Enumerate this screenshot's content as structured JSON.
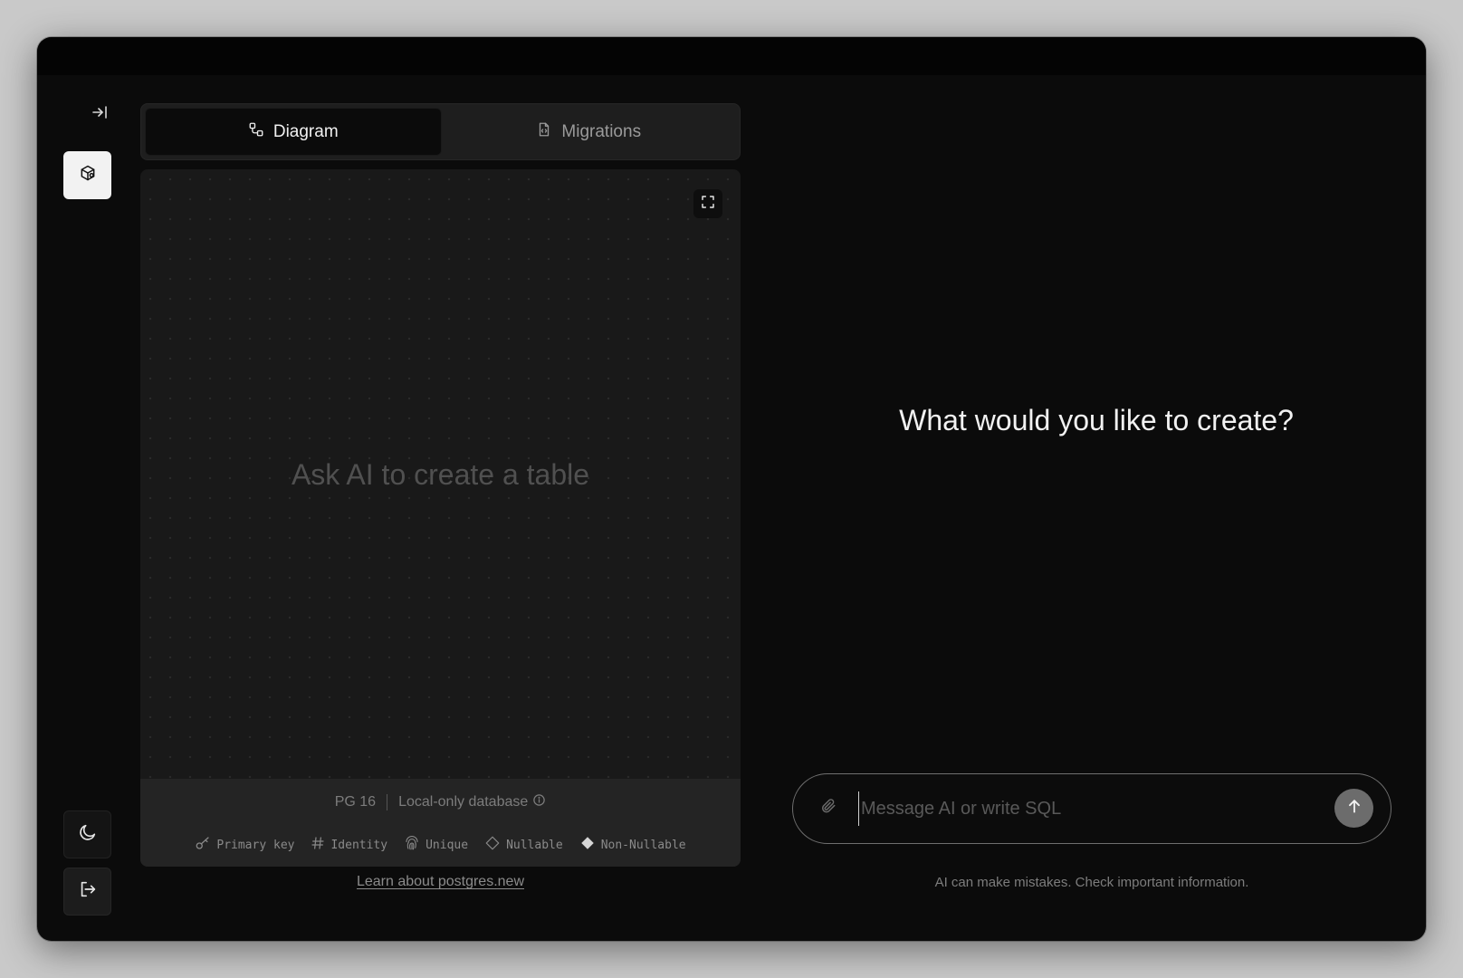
{
  "tabs": [
    {
      "label": "Diagram",
      "icon": "diagram-icon",
      "active": true
    },
    {
      "label": "Migrations",
      "icon": "file-code-icon",
      "active": false
    }
  ],
  "rail": {
    "collapse_icon": "sidebar-expand-icon",
    "database_icon": "database-cube-icon",
    "theme_icon": "moon-icon",
    "logout_icon": "logout-icon"
  },
  "diagram": {
    "empty_hint": "Ask AI to create a table",
    "expand_icon": "expand-icon",
    "pg_version": "PG 16",
    "db_label": "Local-only database",
    "legend": [
      {
        "label": "Primary key",
        "icon": "key-icon"
      },
      {
        "label": "Identity",
        "icon": "hash-icon"
      },
      {
        "label": "Unique",
        "icon": "fingerprint-icon"
      },
      {
        "label": "Nullable",
        "icon": "diamond-outline-icon"
      },
      {
        "label": "Non-Nullable",
        "icon": "diamond-filled-icon"
      }
    ]
  },
  "learn_link": "Learn about postgres.new",
  "chat": {
    "headline": "What would you like to create?",
    "placeholder": "Message AI or write SQL",
    "input_value": "",
    "disclaimer": "AI can make mistakes. Check important information."
  },
  "colors": {
    "window_bg": "#0b0b0b",
    "panel_bg": "#191919",
    "active_rail_button": "#f2f2f2",
    "send_button": "#6c6c6c"
  }
}
